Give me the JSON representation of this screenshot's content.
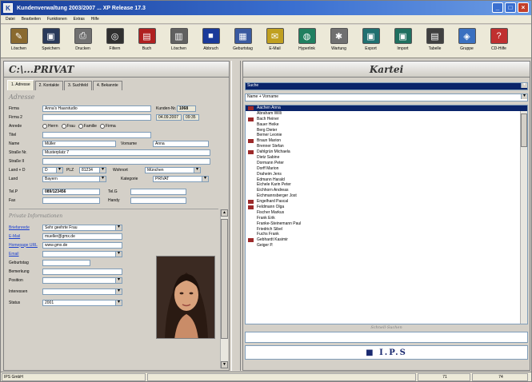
{
  "window": {
    "title": "Kundenverwaltung 2003/2007 ...  XP Release 17.3",
    "buttons": [
      "_",
      "□",
      "×"
    ]
  },
  "menu": [
    "Datei",
    "Bearbeiten",
    "Funktionen",
    "Extras",
    "Hilfe"
  ],
  "toolbar": [
    {
      "label": "Löschen",
      "icon": "eraser-icon",
      "color": "#8a6a30",
      "glyph": "✎"
    },
    {
      "label": "Speichern",
      "icon": "floppy-icon",
      "color": "#2a3a5a",
      "glyph": "▣"
    },
    {
      "label": "Drucken",
      "icon": "printer-icon",
      "color": "#707070",
      "glyph": "⎙"
    },
    {
      "label": "Filtern",
      "icon": "binoculars-icon",
      "color": "#303030",
      "glyph": "◎"
    },
    {
      "label": "Buch",
      "icon": "book-icon",
      "color": "#b02020",
      "glyph": "▤"
    },
    {
      "label": "Löschen",
      "icon": "trash-icon",
      "color": "#606060",
      "glyph": "▥"
    },
    {
      "label": "Abbruch",
      "icon": "stop-icon",
      "color": "#1a3a9a",
      "glyph": "■"
    },
    {
      "label": "Geburtstag",
      "icon": "calendar-icon",
      "color": "#3a5aa0",
      "glyph": "▦"
    },
    {
      "label": "E-Mail",
      "icon": "mail-icon",
      "color": "#c0a020",
      "glyph": "✉"
    },
    {
      "label": "Hyperlink",
      "icon": "globe-icon",
      "color": "#208060",
      "glyph": "◍"
    },
    {
      "label": "Wartung",
      "icon": "tools-icon",
      "color": "#707070",
      "glyph": "✱"
    },
    {
      "label": "Export",
      "icon": "export-icon",
      "color": "#207070",
      "glyph": "▣"
    },
    {
      "label": "Import",
      "icon": "import-icon",
      "color": "#207060",
      "glyph": "▣"
    },
    {
      "label": "Tabelle",
      "icon": "table-icon",
      "color": "#404040",
      "glyph": "▤"
    },
    {
      "label": "Gruppe",
      "icon": "group-icon",
      "color": "#3a70c0",
      "glyph": "◈"
    },
    {
      "label": "CD-Hilfe",
      "icon": "help-icon",
      "color": "#c03030",
      "glyph": "?"
    }
  ],
  "left": {
    "title": "C:\\...PRIVAT",
    "tabs": [
      "1. Adresse",
      "2. Kontakte",
      "3. Suchfeld",
      "4. Bekannte"
    ],
    "section_address": "Adresse",
    "fields": {
      "firma_label": "Firma",
      "firma_value": "Anna's Haarstudio",
      "kunden_nr_label": "Kunden-Nr.",
      "kunden_nr_value": "1068",
      "firma2_label": "Firma 2",
      "datum_value": "04.09.2007",
      "time_value": "09:35",
      "anrede_label": "Anrede",
      "anrede_opts": [
        "Herrn",
        "Frau",
        "Familie",
        "Firma"
      ],
      "titel_label": "Titel",
      "name_label": "Name",
      "name_value": "Müller",
      "vorname_label": "Vorname",
      "vorname_value": "Anna",
      "strasse_label": "Straße Nr.",
      "strasse_value": "Musterplatz 7",
      "strasse2_label": "Straße II",
      "land_plz_label": "Land + D",
      "land_value": "D",
      "plz_label": "PLZ",
      "plz_value": "81234",
      "wohnort_label": "Wohnort",
      "wohnort_value": "München",
      "land2_label": "Land",
      "land2_value": "Bayern",
      "kategorie_label": "Kategorie",
      "kategorie_value": "PRIVAT",
      "tel_label": "Tel.P",
      "tel_value": "089/123456",
      "tel2_label": "Tel.G",
      "fax_label": "Fax",
      "handy_label": "Handy"
    },
    "section_personal": "Private Informationen",
    "personal": {
      "briefanrede_label": "Briefanrede",
      "briefanrede_value": "Sehr geehrte Frau",
      "email_label": "E-Mail",
      "email_value": "mueller@gmx.de",
      "homepage_label": "Homepage URL",
      "homepage_value": "www.gmx.de",
      "email2_label": "Email",
      "geburtstag_label": "Geburtstag",
      "bemerkung_label": "Bemerkung",
      "position_label": "Position",
      "interessen_label": "Interessen",
      "status_label": "Status",
      "status_value": "2001"
    }
  },
  "right": {
    "title": "Kartei",
    "search_value": "Suche",
    "filter_value": "Name + Vorname",
    "list": [
      {
        "name": "Aachen Anna",
        "marked": true,
        "selected": true
      },
      {
        "name": "Abraham Willi",
        "marked": false
      },
      {
        "name": "Bach Heiner",
        "marked": true
      },
      {
        "name": "Bauer Heike",
        "marked": false
      },
      {
        "name": "Berg Dieter",
        "marked": false
      },
      {
        "name": "Berner Leonie",
        "marked": false
      },
      {
        "name": "Braun Marion",
        "marked": true
      },
      {
        "name": "Brenner Stefan",
        "marked": false
      },
      {
        "name": "Dahlgrün Michaela",
        "marked": true
      },
      {
        "name": "Dietz Sabine",
        "marked": false
      },
      {
        "name": "Dormann Peter",
        "marked": false
      },
      {
        "name": "Dorff Marion",
        "marked": false
      },
      {
        "name": "Draheim Jens",
        "marked": false
      },
      {
        "name": "Edmann Harald",
        "marked": false
      },
      {
        "name": "Eichele Karin Peter",
        "marked": false
      },
      {
        "name": "Eichhorn Andreas",
        "marked": false
      },
      {
        "name": "Eichmannsberger Jost",
        "marked": false
      },
      {
        "name": "Engelhard Pascal",
        "marked": true
      },
      {
        "name": "Feldmann Olga",
        "marked": true
      },
      {
        "name": "Fischer Markus",
        "marked": false
      },
      {
        "name": "Frank Erik",
        "marked": false
      },
      {
        "name": "Franke-Steinemann Paul",
        "marked": false
      },
      {
        "name": "Friedrich Sibel",
        "marked": false
      },
      {
        "name": "Fuchs Frank",
        "marked": false
      },
      {
        "name": "Gebhardt Kasimir",
        "marked": true
      },
      {
        "name": "Geiger P.",
        "marked": false
      }
    ],
    "bottom_label": "Schnell-Suchen",
    "logo": "■ I.P.S"
  },
  "status": [
    "IPS GmbH",
    "",
    "71",
    "74"
  ]
}
